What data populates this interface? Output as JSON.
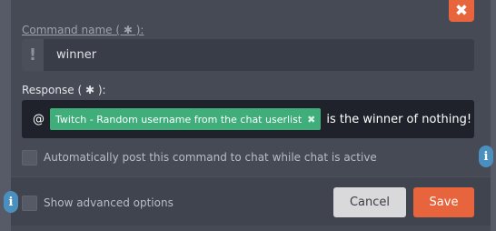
{
  "dialog": {
    "close_icon": "close-icon",
    "close_glyph": "✖"
  },
  "command": {
    "label": "Command name ( ✱ ):",
    "prefix": "!",
    "value": "winner"
  },
  "response": {
    "label": "Response ( ✱ ):",
    "prefix_text": "@",
    "tag_label": "Twitch - Random username from the chat userlist",
    "tag_remove": "✖",
    "suffix_text": "is the winner of nothing!"
  },
  "options": {
    "auto_post_label": "Automatically post this command to chat while chat is active",
    "advanced_label": "Show advanced options",
    "info_glyph": "i"
  },
  "buttons": {
    "cancel": "Cancel",
    "save": "Save"
  },
  "colors": {
    "accent": "#e8643c",
    "tag": "#3fae7a",
    "info": "#4b8fbf"
  }
}
